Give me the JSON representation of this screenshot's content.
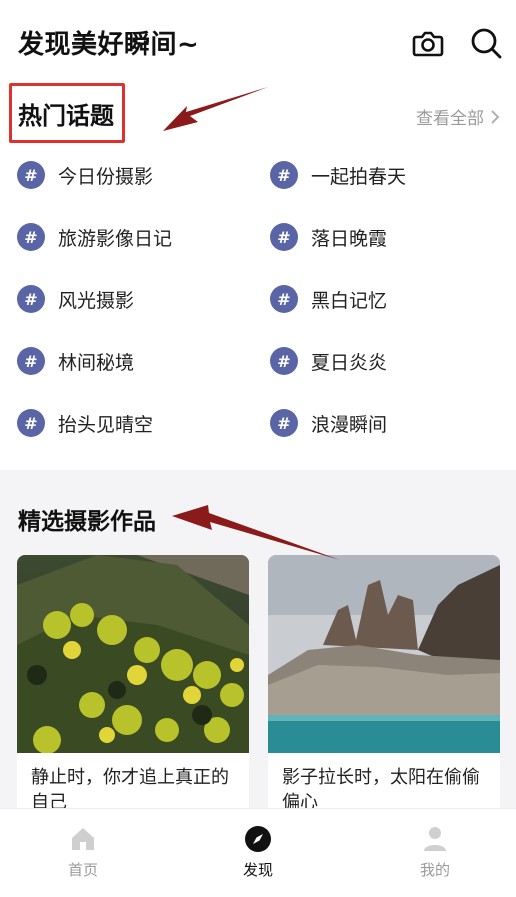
{
  "header": {
    "title": "发现美好瞬间~",
    "camera_icon": "camera-icon",
    "search_icon": "search-icon"
  },
  "topics": {
    "title": "热门话题",
    "view_all": "查看全部",
    "hash_symbol": "#",
    "items": [
      {
        "label": "今日份摄影"
      },
      {
        "label": "一起拍春天"
      },
      {
        "label": "旅游影像日记"
      },
      {
        "label": "落日晚霞"
      },
      {
        "label": "风光摄影"
      },
      {
        "label": "黑白记忆"
      },
      {
        "label": "林间秘境"
      },
      {
        "label": "夏日炎炎"
      },
      {
        "label": "抬头见晴空"
      },
      {
        "label": "浪漫瞬间"
      }
    ],
    "accent_color": "#5a65a6"
  },
  "featured": {
    "title": "精选摄影作品",
    "cards": [
      {
        "caption": "静止时，你才追上真正的自己"
      },
      {
        "caption": "影子拉长时，太阳在偷偷偏心"
      }
    ]
  },
  "tabbar": {
    "tabs": [
      {
        "label": "首页",
        "icon": "home-icon"
      },
      {
        "label": "发现",
        "icon": "compass-icon",
        "active": true
      },
      {
        "label": "我的",
        "icon": "user-icon"
      }
    ]
  },
  "colors": {
    "annotation_box": "#e0312f",
    "annotation_arrow": "#8b1a1a"
  }
}
